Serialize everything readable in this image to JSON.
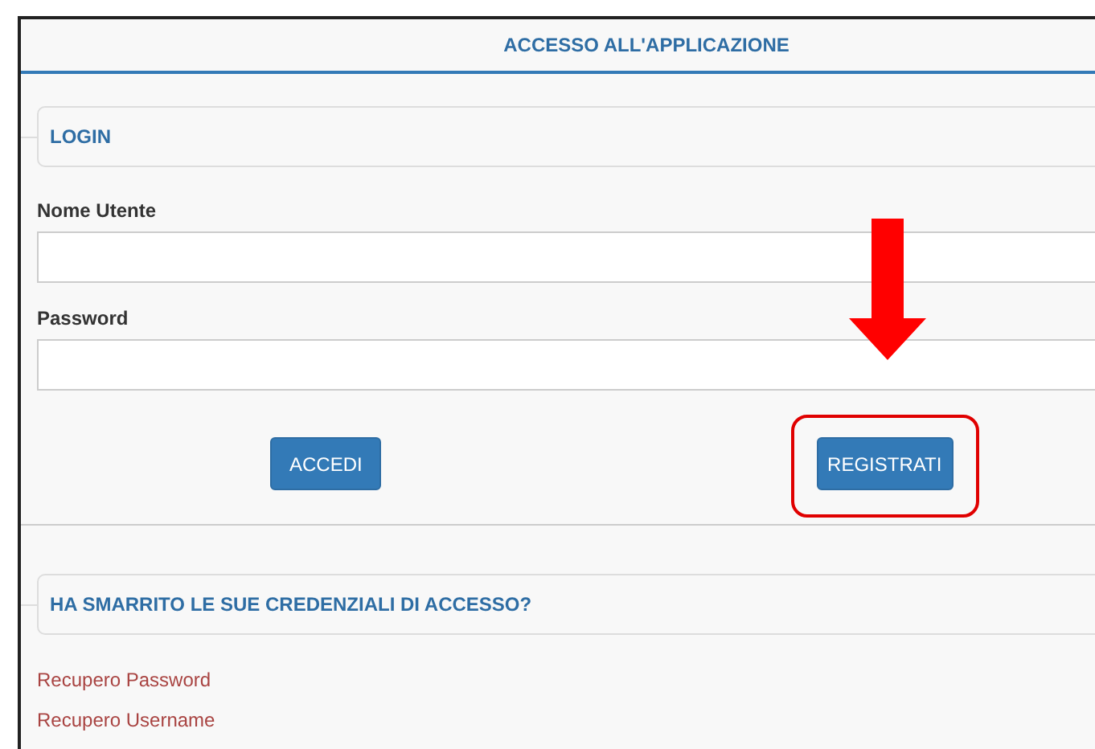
{
  "window": {
    "title": "ACCESSO ALL'APPLICAZIONE"
  },
  "login": {
    "title": "LOGIN",
    "fields": [
      {
        "label": "Nome Utente"
      },
      {
        "label": "Password"
      }
    ],
    "buttons": [
      {
        "label": "ACCEDI",
        "highlighted": false
      },
      {
        "label": "REGISTRATI",
        "highlighted": true
      }
    ]
  },
  "recovery": {
    "title": "HA SMARRITO LE SUE CREDENZIALI DI ACCESSO?",
    "links": [
      "Recupero Password",
      "Recupero Username"
    ]
  }
}
